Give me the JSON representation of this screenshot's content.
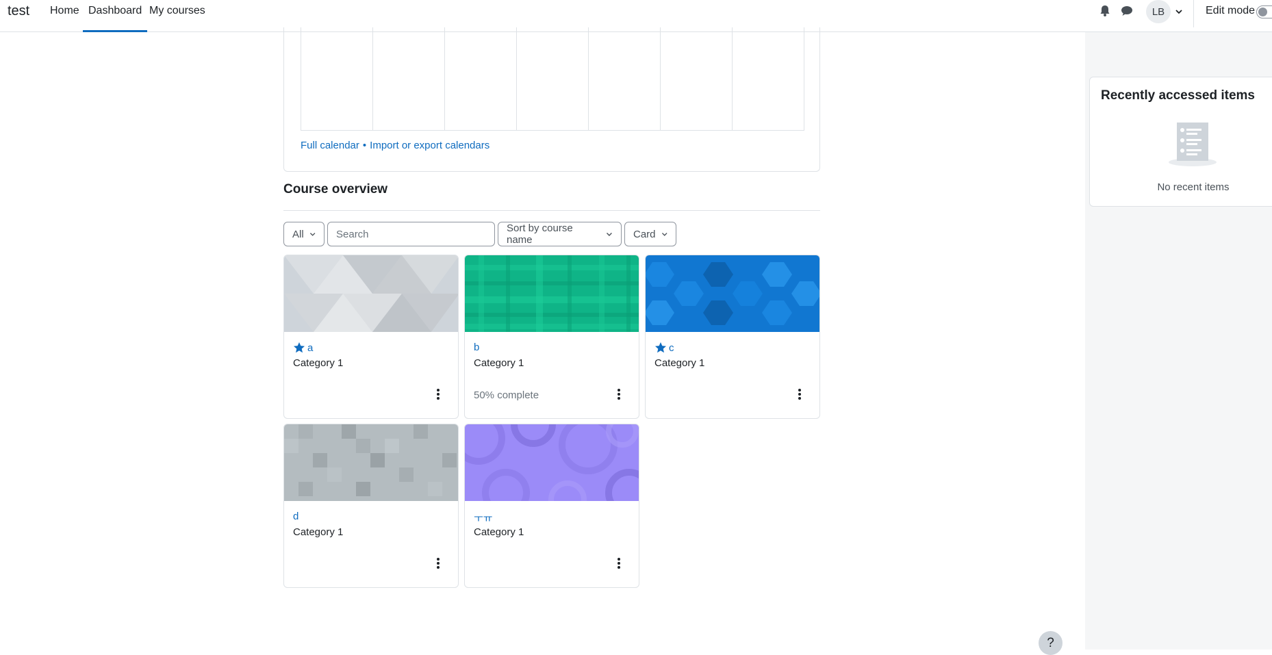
{
  "navbar": {
    "site_name": "test",
    "links": [
      {
        "label": "Home"
      },
      {
        "label": "Dashboard"
      },
      {
        "label": "My courses"
      }
    ],
    "avatar_initials": "LB",
    "edit_mode_label": "Edit mode",
    "icons": [
      "bell-icon",
      "chat-icon",
      "chevron-down-icon"
    ]
  },
  "calendar": {
    "full_calendar_link": "Full calendar",
    "separator": "•",
    "import_export_link": "Import or export calendars"
  },
  "course_overview": {
    "title": "Course overview",
    "filter_label": "All",
    "search_placeholder": "Search",
    "sort_label": "Sort by course name",
    "view_label": "Card",
    "courses": [
      {
        "name": "a",
        "category": "Category 1",
        "starred": true,
        "progress": "",
        "color": "#ced4da"
      },
      {
        "name": "b",
        "category": "Category 1",
        "starred": false,
        "progress": "50% complete",
        "color": "#0fb487"
      },
      {
        "name": "c",
        "category": "Category 1",
        "starred": true,
        "progress": "",
        "color": "#1177d1"
      },
      {
        "name": "d",
        "category": "Category 1",
        "starred": false,
        "progress": "",
        "color": "#b4bcc0"
      },
      {
        "name": "ㅜㅠ",
        "category": "Category 1",
        "starred": false,
        "progress": "",
        "color": "#9b8bf8"
      }
    ]
  },
  "recent_items": {
    "title": "Recently accessed items",
    "empty_text": "No recent items"
  },
  "help_button_label": "?",
  "colors": {
    "accent": "#0f6cbf",
    "border": "#dee2e6",
    "drawer_bg": "#f5f6f7"
  }
}
